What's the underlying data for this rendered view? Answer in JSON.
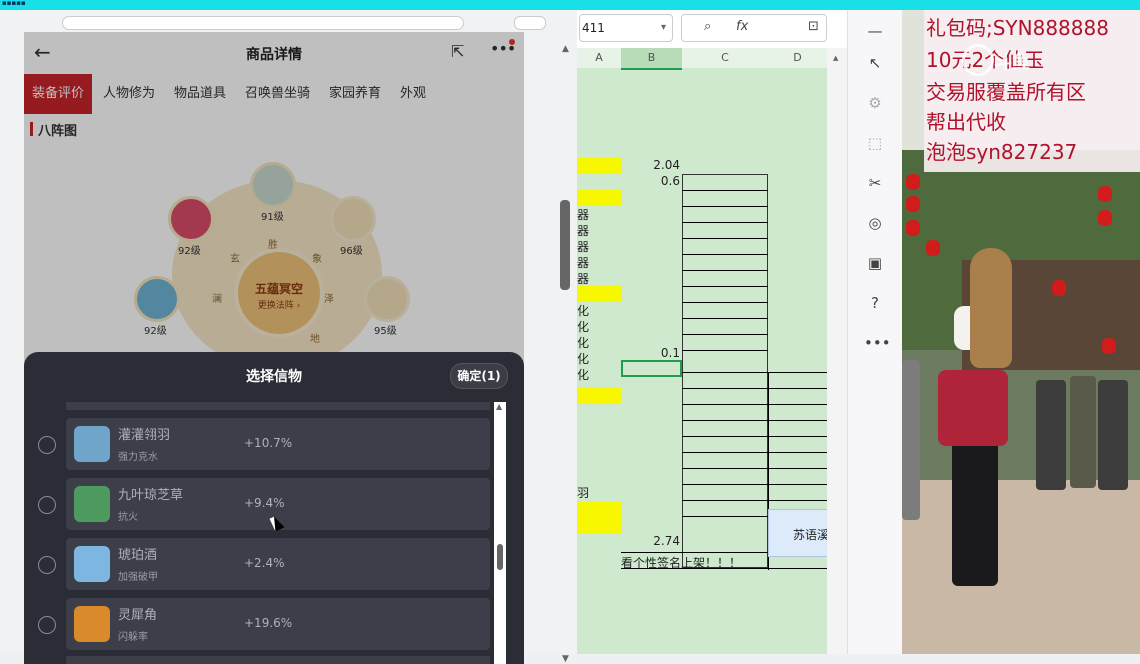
{
  "phone": {
    "title": "商品详情",
    "tabs": [
      "装备评价",
      "人物修为",
      "物品道具",
      "召唤兽坐骑",
      "家园养育",
      "外观"
    ],
    "section_title": "八阵图",
    "wheel": {
      "core_title": "五蕴冥空",
      "core_sub": "更换法阵 ›",
      "levels": [
        "91级",
        "92级",
        "96级",
        "92级",
        "95级"
      ],
      "ring_chars": [
        "玄",
        "胜",
        "象",
        "澜",
        "泽",
        "地"
      ]
    },
    "modal": {
      "title": "选择信物",
      "confirm": "确定(1)",
      "items": [
        {
          "name": "灌灌翎羽",
          "sub": "强力克水",
          "value": "+10.7%",
          "color": "#6fa5c9"
        },
        {
          "name": "九叶琼芝草",
          "sub": "抗火",
          "value": "+9.4%",
          "color": "#4e9a5e"
        },
        {
          "name": "琥珀酒",
          "sub": "加强破甲",
          "value": "+2.4%",
          "color": "#7db6e0"
        },
        {
          "name": "灵犀角",
          "sub": "闪躲率",
          "value": "+19.6%",
          "color": "#d98a2a"
        }
      ]
    }
  },
  "sheet": {
    "cell_ref": "411",
    "fx": "fx",
    "columns": [
      "A",
      "B",
      "C",
      "D"
    ],
    "values": {
      "b1": "2.04",
      "b2": "0.6",
      "b3": "0.1",
      "b4": "2.74"
    },
    "row_chars": [
      "器",
      "器",
      "器",
      "器",
      "器",
      "化",
      "化",
      "化",
      "化",
      "化",
      "羽"
    ],
    "blue_cell": "苏语溪",
    "note": "看个性签名上架！！！"
  },
  "sidebar_icons": [
    "minimize-icon",
    "select-arrow-icon",
    "adjust-icon",
    "crop-icon",
    "tools-icon",
    "sticker-icon",
    "book-icon",
    "help-icon",
    "more-icon"
  ],
  "stream": {
    "lines": [
      "礼包码;SYN888888",
      "10元2个仙玉",
      "交易服覆盖所有区",
      "帮出代收",
      "泡泡syn827237"
    ],
    "watermark": "斗鱼"
  }
}
